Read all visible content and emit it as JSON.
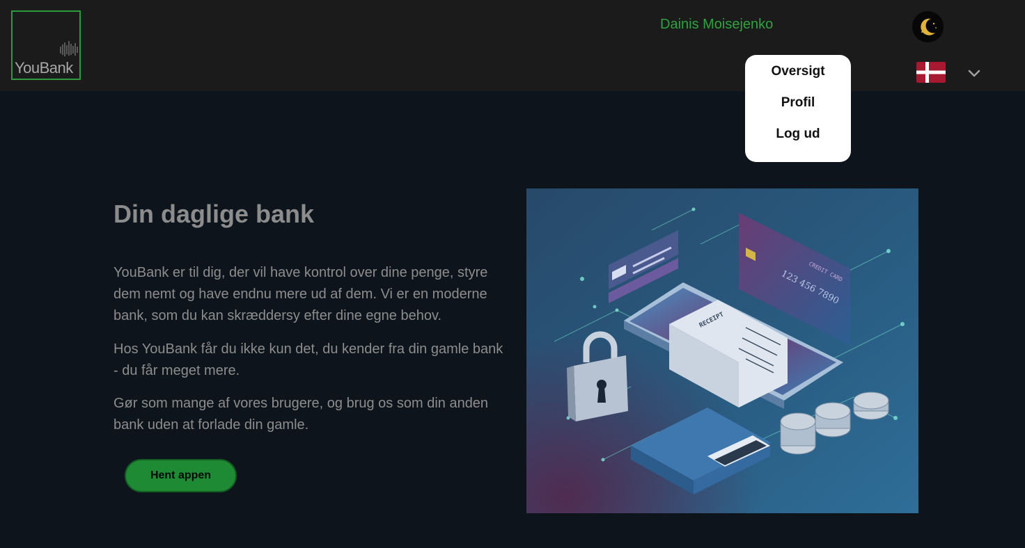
{
  "header": {
    "logo_text": "YouBank",
    "user_name": "Dainis Moisejenko",
    "language": "Dansk (flag)"
  },
  "user_menu": {
    "items": [
      {
        "label": "Oversigt"
      },
      {
        "label": "Profil"
      },
      {
        "label": "Log ud"
      }
    ]
  },
  "hero": {
    "title": "Din daglige bank",
    "paragraphs": [
      "YouBank er til dig, der vil have kontrol over dine penge, styre dem nemt og have endnu mere ud af dem. Vi er en moderne bank, som du kan skræddersy efter dine egne behov.",
      "Hos YouBank får du ikke kun det, du kender fra din gamle bank - du får meget mere.",
      "Gør som mange af vores brugere, og brug os som din anden bank uden at forlade din gamle."
    ],
    "cta_label": "Hent appen"
  },
  "illustration": {
    "receipt_label": "RECEIPT",
    "card_label": "CREDIT CARD",
    "card_number": "123 456 7890"
  },
  "icons": {
    "logo": "sound-bars-logo",
    "theme": "moon-icon",
    "language": "denmark-flag-icon",
    "menu": "chevron-down-icon"
  },
  "colors": {
    "accent_green": "#2fa33f",
    "button_green": "#1f8a34",
    "header_bg": "#1b1b1b",
    "page_bg": "#0d141b",
    "moon": "#e0b43a"
  }
}
